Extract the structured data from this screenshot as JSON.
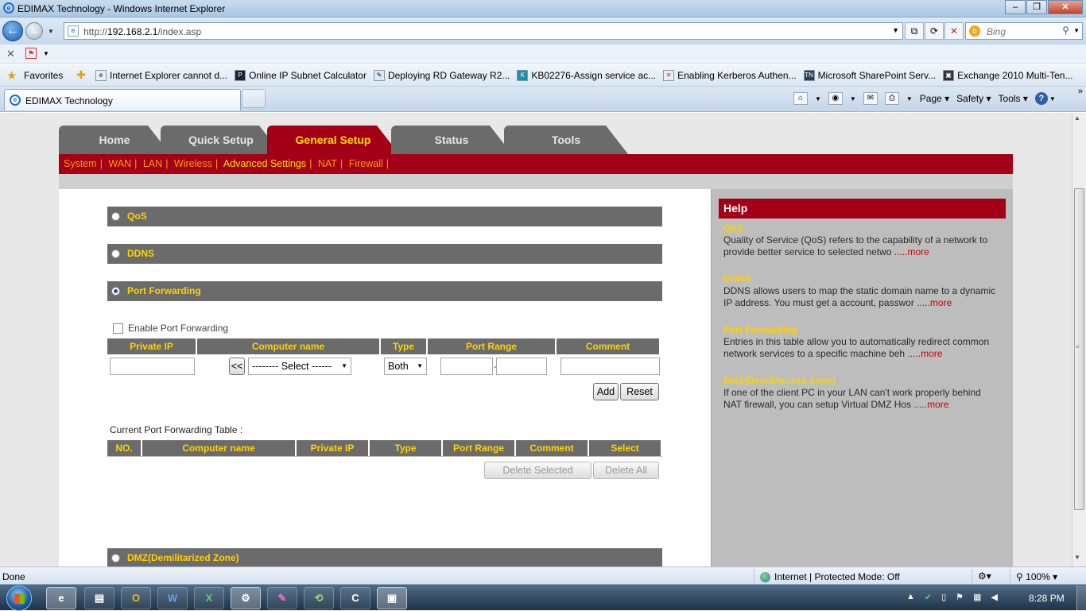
{
  "window": {
    "title": "EDIMAX Technology - Windows Internet Explorer",
    "min": "‒",
    "max": "❐",
    "close": "✕"
  },
  "address": {
    "prefix": "http://",
    "host": "192.168.2.1",
    "path": "/index.asp",
    "search_placeholder": "Bing"
  },
  "favorites": {
    "label": "Favorites",
    "links": [
      "Internet Explorer cannot d...",
      "Online IP Subnet Calculator",
      "Deploying RD Gateway R2...",
      "KB02276-Assign service ac...",
      "Enabling Kerberos Authen...",
      "Microsoft SharePoint Serv...",
      "Exchange 2010 Multi-Ten..."
    ]
  },
  "tab": {
    "title": "EDIMAX Technology"
  },
  "toolbar": {
    "page": "Page ▾",
    "safety": "Safety ▾",
    "tools": "Tools ▾"
  },
  "router": {
    "nav": [
      {
        "label": "Home",
        "active": false
      },
      {
        "label": "Quick Setup",
        "active": false
      },
      {
        "label": "General Setup",
        "active": true
      },
      {
        "label": "Status",
        "active": false
      },
      {
        "label": "Tools",
        "active": false
      }
    ],
    "subnav": [
      "System",
      "WAN",
      "LAN",
      "Wireless",
      "Advanced Settings",
      "NAT",
      "Firewall"
    ],
    "subnav_active": "Advanced Settings",
    "sections": {
      "qos": "QoS",
      "ddns": "DDNS",
      "pf": "Port Forwarding",
      "dmz": "DMZ(Demilitarized Zone)"
    },
    "enable_pf": "Enable Port Forwarding",
    "form_headers": [
      "Private IP",
      "Computer name",
      "Type",
      "Port Range",
      "Comment"
    ],
    "copy_btn": "<<",
    "computer_select": "-------- Select ------",
    "type_select": "Both",
    "range_sep": "-",
    "add": "Add",
    "reset": "Reset",
    "table_label": "Current Port Forwarding Table :",
    "table_headers": [
      "NO.",
      "Computer name",
      "Private IP",
      "Type",
      "Port Range",
      "Comment",
      "Select"
    ],
    "delete_selected": "Delete Selected",
    "delete_all": "Delete All"
  },
  "help": {
    "title": "Help",
    "more": ".....more",
    "items": [
      {
        "h": "QoS",
        "p": "Quality of Service (QoS) refers to the capability of a network to provide better service to selected netwo "
      },
      {
        "h": "DDNS",
        "p": "DDNS allows users to map the static domain name to a dynamic IP address. You must get a account, passwor "
      },
      {
        "h": "Port Forwarding",
        "p": "Entries in this table allow you to automatically redirect common network services to a specific machine beh "
      },
      {
        "h": "DMZ(Demilitarized Zone)",
        "p": "If one of the client PC in your LAN can't work properly behind NAT firewall, you can setup Virtual DMZ Hos "
      }
    ]
  },
  "status": {
    "done": "Done",
    "zone": "Internet | Protected Mode: Off",
    "zoom": "100%"
  },
  "clock": "8:28 PM"
}
